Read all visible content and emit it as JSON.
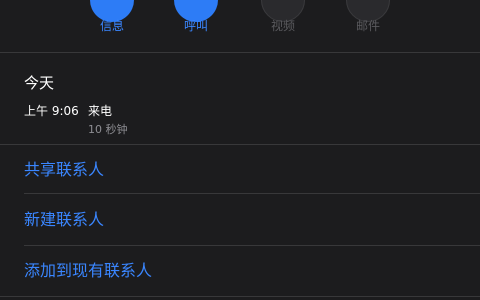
{
  "actions": [
    {
      "label": "信息",
      "state": "enabled"
    },
    {
      "label": "呼叫",
      "state": "enabled"
    },
    {
      "label": "视频",
      "state": "disabled"
    },
    {
      "label": "邮件",
      "state": "disabled"
    }
  ],
  "history": {
    "section_title": "今天",
    "entries": [
      {
        "time": "上午 9:06",
        "type": "来电",
        "duration": "10 秒钟"
      }
    ]
  },
  "links": [
    {
      "label": "共享联系人"
    },
    {
      "label": "新建联系人"
    },
    {
      "label": "添加到现有联系人"
    }
  ],
  "colors": {
    "background": "#1c1c1e",
    "accent": "#3a86ff",
    "disabled": "#5a5a5e",
    "separator": "#38383a",
    "secondary_text": "#8e8e93"
  }
}
